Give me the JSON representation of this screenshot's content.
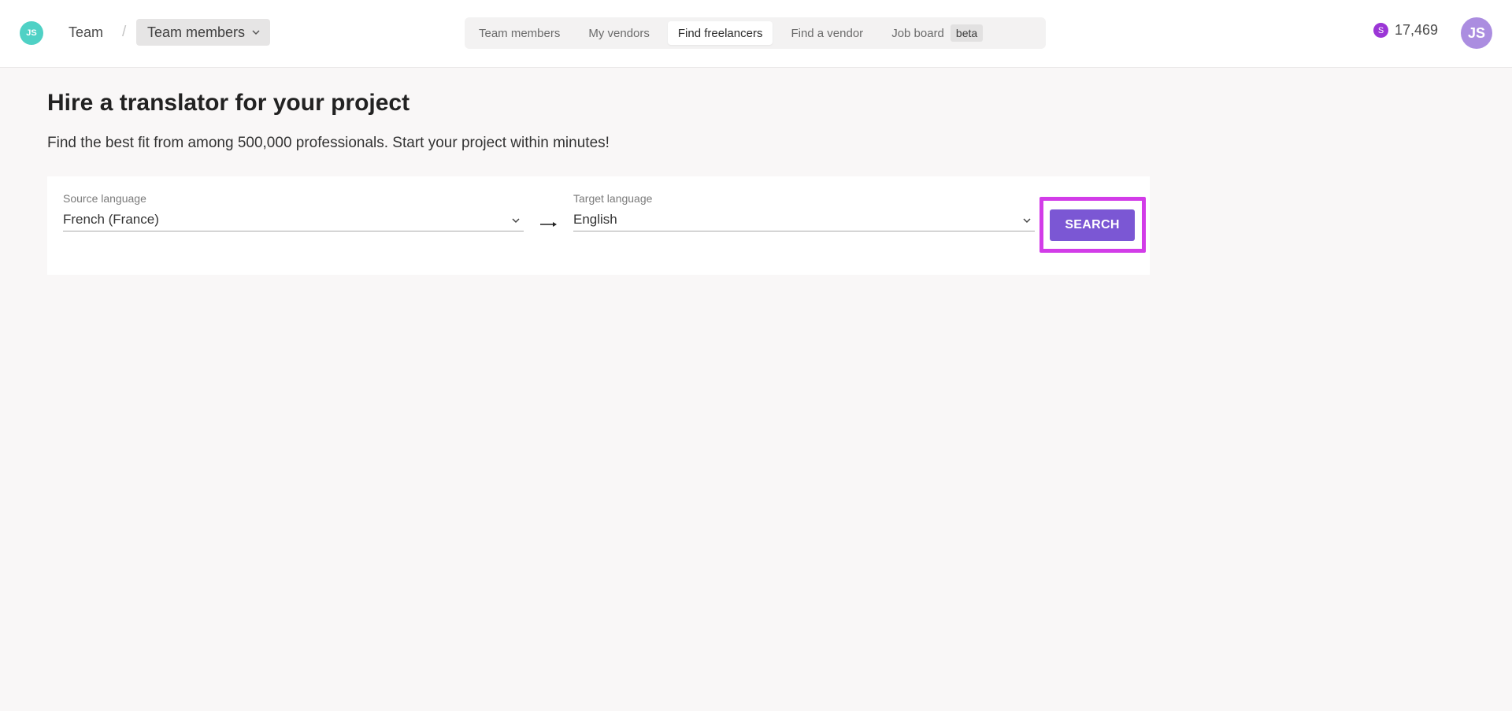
{
  "header": {
    "team_logo_initials": "JS",
    "breadcrumb": {
      "team": "Team",
      "separator": "/",
      "current": "Team members"
    },
    "tabs": [
      {
        "label": "Team members",
        "active": false
      },
      {
        "label": "My vendors",
        "active": false
      },
      {
        "label": "Find freelancers",
        "active": true
      },
      {
        "label": "Find a vendor",
        "active": false
      },
      {
        "label": "Job board",
        "badge": "beta",
        "active": false
      }
    ],
    "credits": {
      "coin_symbol": "S",
      "amount": "17,469"
    },
    "avatar_initials": "JS"
  },
  "main": {
    "title": "Hire a translator for your project",
    "subtitle": "Find the best fit from among 500,000 professionals. Start your project within minutes!",
    "search": {
      "source": {
        "label": "Source language",
        "value": "French (France)"
      },
      "target": {
        "label": "Target language",
        "value": "English"
      },
      "button_label": "SEARCH"
    }
  },
  "colors": {
    "accent": "#7b57d4",
    "highlight": "#d23ce8",
    "team_logo": "#4fd1c5",
    "avatar": "#ab8de0",
    "coin": "#9b36d6",
    "background": "#f9f7f7"
  },
  "icons": {
    "breadcrumb_dropdown": "chevron-down-icon",
    "select_dropdown": "chevron-down-icon",
    "language_direction": "arrow-right-icon",
    "credits": "coin-icon"
  }
}
